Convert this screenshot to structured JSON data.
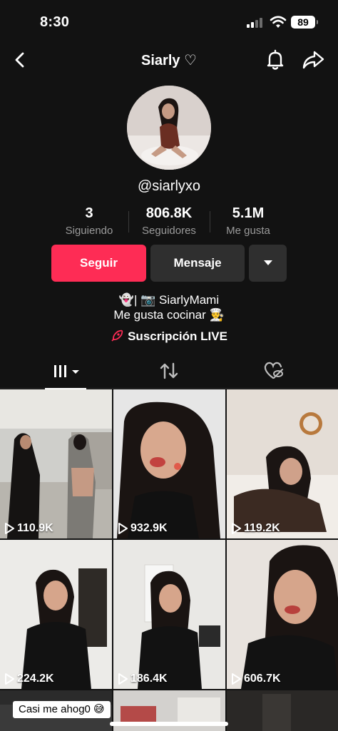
{
  "status": {
    "time": "8:30",
    "battery": "89"
  },
  "header": {
    "title": "Siarly ♡"
  },
  "profile": {
    "username": "@siarlyxo",
    "stats": [
      {
        "value": "3",
        "label": "Siguiendo"
      },
      {
        "value": "806.8K",
        "label": "Seguidores"
      },
      {
        "value": "5.1M",
        "label": "Me gusta"
      }
    ],
    "bio_line1": "👻| 📷 SiarlyMami",
    "bio_line2": "Me gusta cocinar 👨‍🍳",
    "live_label": "Suscripción LIVE"
  },
  "actions": {
    "follow": "Seguir",
    "message": "Mensaje"
  },
  "videos": [
    {
      "views": "110.9K"
    },
    {
      "views": "932.9K"
    },
    {
      "views": "119.2K"
    },
    {
      "views": "224.2K"
    },
    {
      "views": "186.4K"
    },
    {
      "views": "606.7K"
    }
  ],
  "bottom_caption": "Casi me ahog0 😅",
  "colors": {
    "accent": "#fe2c55",
    "background": "#121212"
  }
}
